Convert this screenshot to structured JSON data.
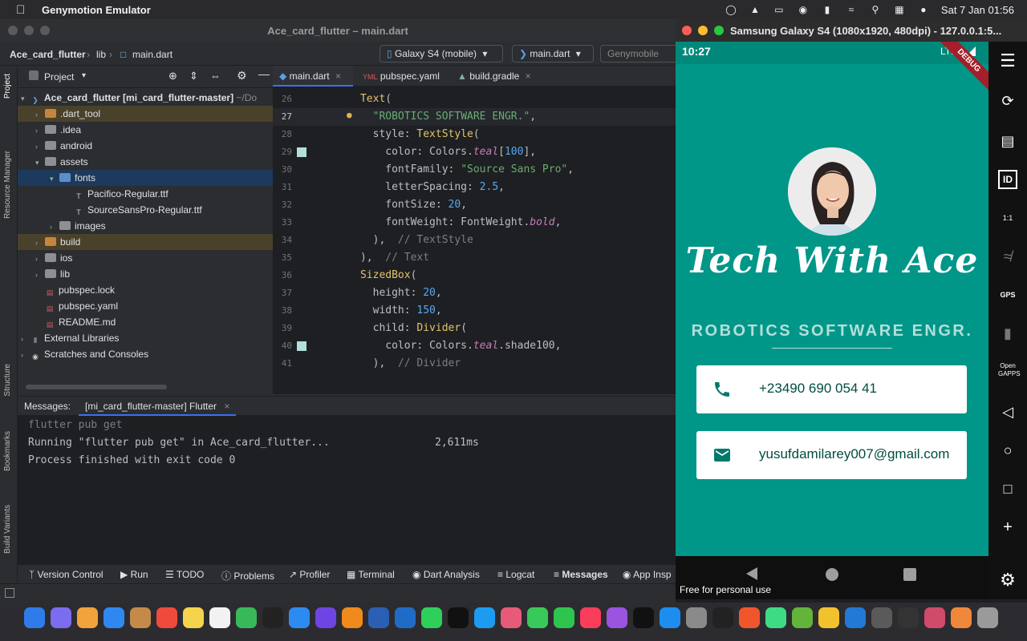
{
  "menubar": {
    "app_name": "Genymotion Emulator",
    "clock": "Sat 7 Jan  01:56"
  },
  "ide": {
    "title": "Ace_card_flutter – main.dart",
    "breadcrumb": [
      "Ace_card_flutter",
      "lib",
      "main.dart"
    ],
    "device_select": "Galaxy S4 (mobile)",
    "config_select": "main.dart",
    "device_manager": "Genymobile",
    "project_label": "Project",
    "side_labels": [
      "Project",
      "Resource Manager",
      "Structure",
      "Bookmarks",
      "Build Variants"
    ],
    "tree": [
      {
        "label": "Ace_card_flutter [mi_card_flutter-master]",
        "suffix": "~/Do",
        "indent": 0,
        "type": "root"
      },
      {
        "label": ".dart_tool",
        "indent": 1,
        "type": "folder-orange",
        "state": "hl"
      },
      {
        "label": ".idea",
        "indent": 1,
        "type": "folder"
      },
      {
        "label": "android",
        "indent": 1,
        "type": "folder"
      },
      {
        "label": "assets",
        "indent": 1,
        "type": "folder",
        "open": true
      },
      {
        "label": "fonts",
        "indent": 2,
        "type": "folder-blue",
        "open": true,
        "state": "sel"
      },
      {
        "label": "Pacifico-Regular.ttf",
        "indent": 3,
        "type": "font"
      },
      {
        "label": "SourceSansPro-Regular.ttf",
        "indent": 3,
        "type": "font"
      },
      {
        "label": "images",
        "indent": 2,
        "type": "folder"
      },
      {
        "label": "build",
        "indent": 1,
        "type": "folder-orange",
        "state": "hl"
      },
      {
        "label": "ios",
        "indent": 1,
        "type": "folder"
      },
      {
        "label": "lib",
        "indent": 1,
        "type": "folder"
      },
      {
        "label": "pubspec.lock",
        "indent": 1,
        "type": "file"
      },
      {
        "label": "pubspec.yaml",
        "indent": 1,
        "type": "file"
      },
      {
        "label": "README.md",
        "indent": 1,
        "type": "file"
      },
      {
        "label": "External Libraries",
        "indent": 0,
        "type": "lib"
      },
      {
        "label": "Scratches and Consoles",
        "indent": 0,
        "type": "scratch"
      }
    ],
    "tabs": [
      "main.dart",
      "pubspec.yaml",
      "build.gradle"
    ],
    "code_lines": [
      {
        "n": "26",
        "html": "      <span class='c-cls'>Text</span>("
      },
      {
        "n": "27",
        "html": "        <span class='c-str'>\"ROBOTICS SOFTWARE ENGR.\"</span>,"
      },
      {
        "n": "28",
        "html": "        style: <span class='c-cls'>TextStyle</span>("
      },
      {
        "n": "29",
        "html": "          color: Colors.<span class='c-it'>teal</span>[<span class='c-num'>100</span>],"
      },
      {
        "n": "30",
        "html": "          fontFamily: <span class='c-str'>\"Source Sans Pro\"</span>,"
      },
      {
        "n": "31",
        "html": "          letterSpacing: <span class='c-num'>2.5</span>,"
      },
      {
        "n": "32",
        "html": "          fontSize: <span class='c-num'>20</span>,"
      },
      {
        "n": "33",
        "html": "          fontWeight: FontWeight.<span class='c-it'>bold</span>,"
      },
      {
        "n": "34",
        "html": "        ),  <span class='c-com'>// TextStyle</span>"
      },
      {
        "n": "35",
        "html": "      ),  <span class='c-com'>// Text</span>"
      },
      {
        "n": "36",
        "html": "      <span class='c-cls'>SizedBox</span>("
      },
      {
        "n": "37",
        "html": "        height: <span class='c-num'>20</span>,"
      },
      {
        "n": "38",
        "html": "        width: <span class='c-num'>150</span>,"
      },
      {
        "n": "39",
        "html": "        child: <span class='c-cls'>Divider</span>("
      },
      {
        "n": "40",
        "html": "          color: Colors.<span class='c-it'>teal</span>.shade100,"
      },
      {
        "n": "41",
        "html": "        ),  <span class='c-com'>// Divider</span>"
      }
    ],
    "messages_label": "Messages:",
    "messages_tab": "[mi_card_flutter-master] Flutter",
    "messages": [
      {
        "text": "flutter pub get",
        "dim": true
      },
      {
        "text": "Running \"flutter pub get\" in Ace_card_flutter...",
        "time": "2,611ms"
      },
      {
        "text": "Process finished with exit code 0"
      }
    ],
    "bottom_tools": [
      "Version Control",
      "Run",
      "TODO",
      "Problems",
      "Profiler",
      "Terminal",
      "Dart Analysis",
      "Logcat",
      "Messages",
      "App Insp"
    ]
  },
  "emulator": {
    "title": "Samsung Galaxy S4 (1080x1920, 480dpi) - 127.0.0.1:5...",
    "time": "10:27",
    "network": "LTE",
    "debug_banner": "DEBUG",
    "name": "Tech With Ace",
    "job": "ROBOTICS SOFTWARE ENGR.",
    "phone": "+23490 690 054 41",
    "email": "yusufdamilarey007@gmail.com",
    "watermark": "Free for personal use",
    "side_labels": {
      "id": "ID",
      "ratio": "1:1",
      "gps": "GPS",
      "gapps": "Open GAPPS"
    },
    "colors": {
      "background": "#009688",
      "card_text": "#004d40",
      "icon": "#00796b",
      "job": "#b2dfdb"
    }
  }
}
